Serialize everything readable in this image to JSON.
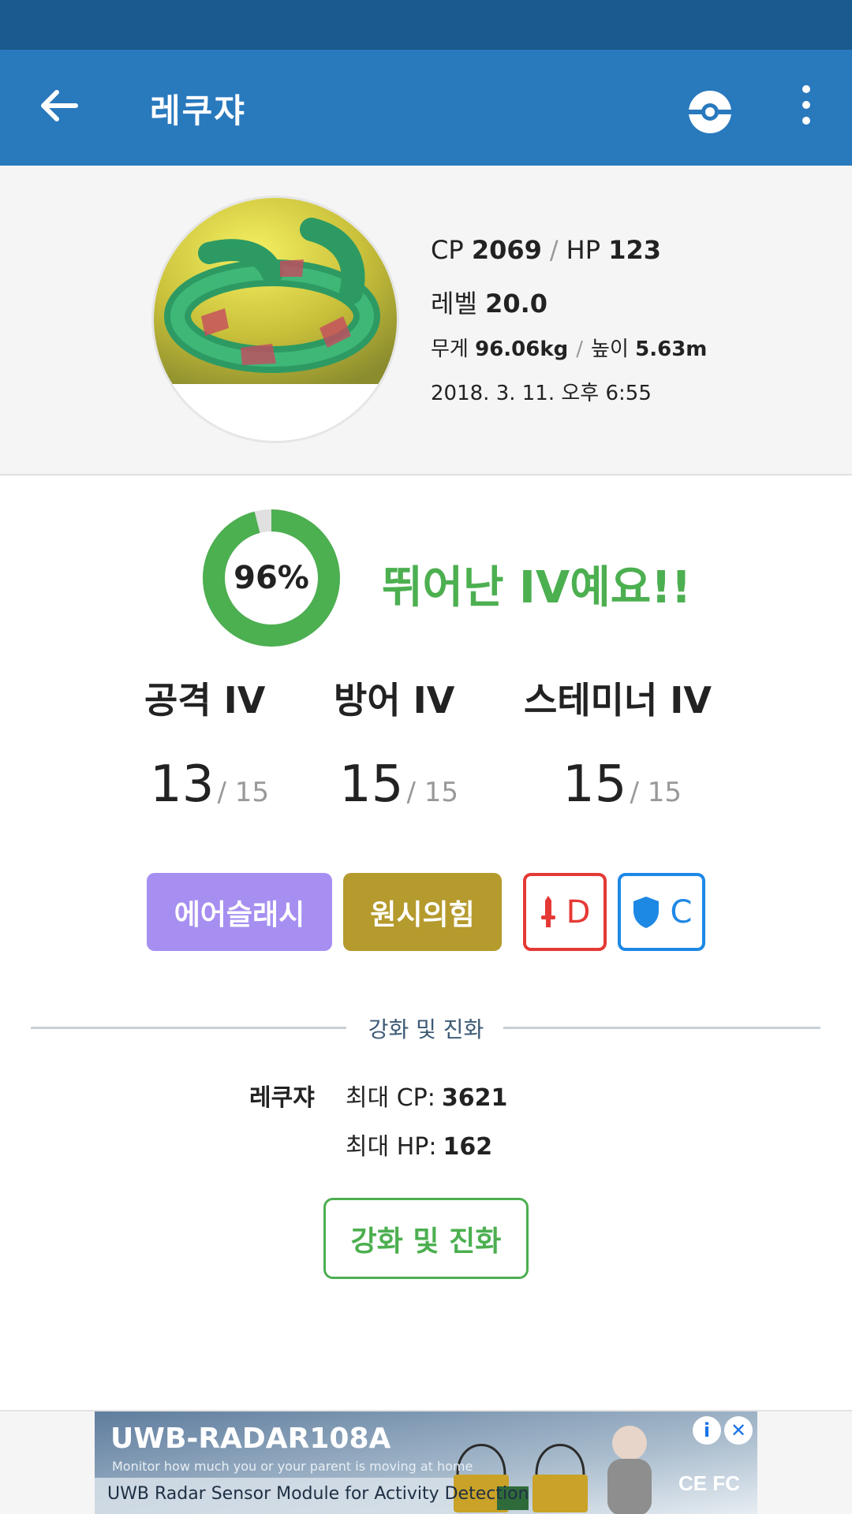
{
  "app_bar": {
    "title": "레쿠쟈",
    "back_icon": "arrow-left-icon",
    "pokeball_icon": "pokeball-icon",
    "more_icon": "more-vertical-icon"
  },
  "summary": {
    "cp_label": "CP",
    "cp_value": "2069",
    "hp_label": "HP",
    "hp_value": "123",
    "level_label": "레벨",
    "level_value": "20.0",
    "weight_label": "무게",
    "weight_value": "96.06kg",
    "height_label": "높이",
    "height_value": "5.63m",
    "date": "2018. 3. 11. 오후 6:55",
    "separator": "/"
  },
  "iv": {
    "percent_label": "96%",
    "percent": 96,
    "message": "뛰어난 IV예요!!",
    "ring_color": "#4caf50",
    "stats": [
      {
        "label": "공격 IV",
        "value": "13",
        "max": "/ 15"
      },
      {
        "label": "방어 IV",
        "value": "15",
        "max": "/ 15"
      },
      {
        "label": "스테미너 IV",
        "value": "15",
        "max": "/ 15"
      }
    ]
  },
  "moves": {
    "fast": {
      "label": "에어슬래시",
      "color": "#a68ff0"
    },
    "charged": {
      "label": "원시의힘",
      "color": "#b59a2d"
    },
    "attack_grade": {
      "icon": "sword-icon",
      "grade": "D",
      "color": "#e53935"
    },
    "defense_grade": {
      "icon": "shield-icon",
      "grade": "C",
      "color": "#1e88e5"
    }
  },
  "power_up": {
    "section_label": "강화 및 진화",
    "pokemon_name": "레쿠쟈",
    "max_cp_label": "최대 CP:",
    "max_cp_value": "3621",
    "max_hp_label": "최대 HP:",
    "max_hp_value": "162",
    "button_label": "강화 및 진화"
  },
  "ad": {
    "title": "UWB-RADAR108A",
    "subtitle": "Monitor how much you or your parent is moving at home",
    "tagline": "UWB Radar Sensor Module for Activity Detection",
    "info_icon": "info-icon",
    "close_icon": "close-icon"
  }
}
